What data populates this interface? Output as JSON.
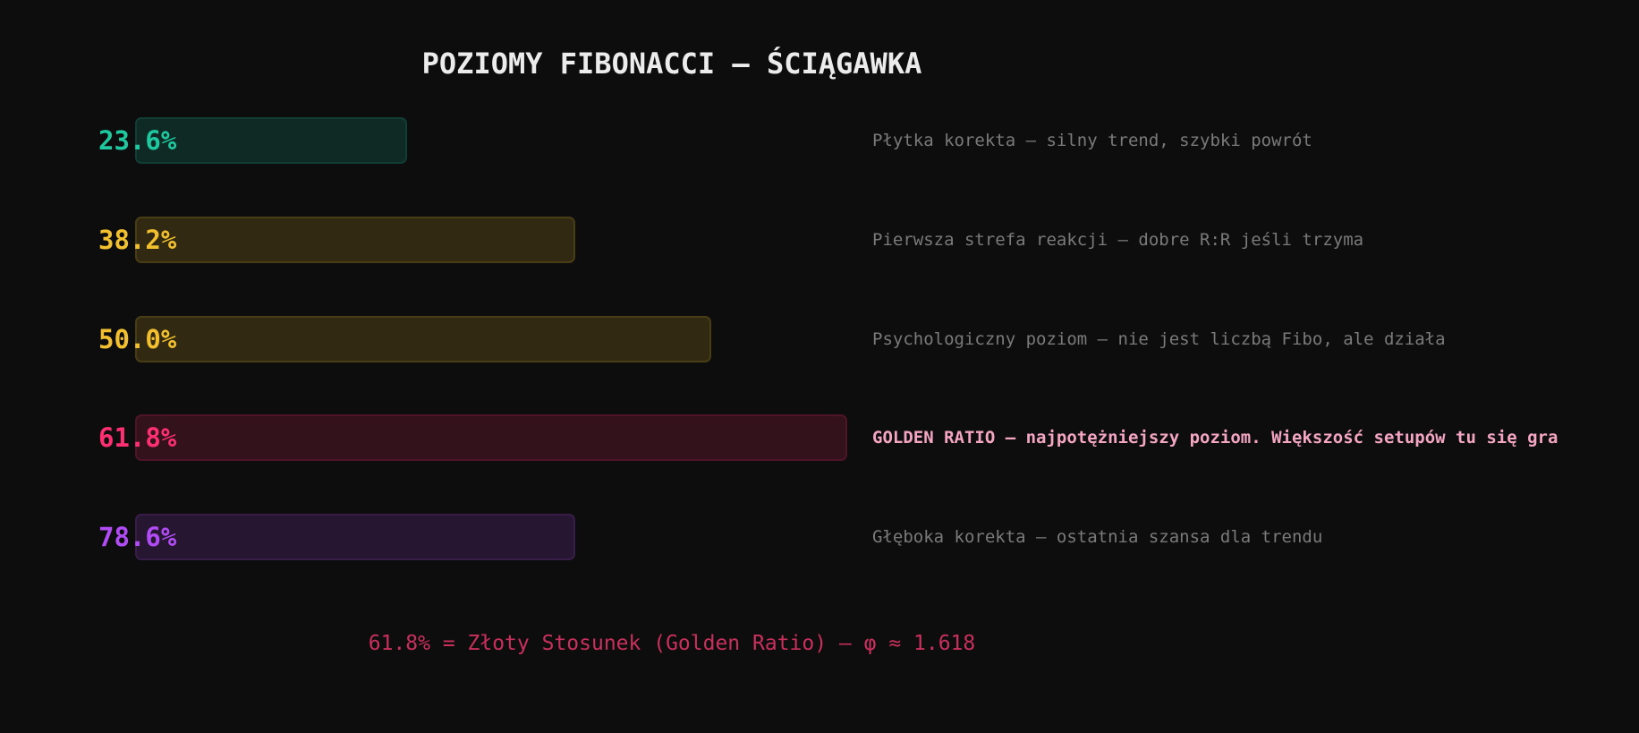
{
  "title": "POZIOMY FIBONACCI — ŚCIĄGAWKA",
  "footnote": "61.8% = Złoty Stosunek (Golden Ratio) — φ ≈ 1.618",
  "chart_data": {
    "type": "bar",
    "orientation": "horizontal",
    "title": "POZIOMY FIBONACCI — ŚCIĄGAWKA",
    "categories": [
      "23.6%",
      "38.2%",
      "50.0%",
      "61.8%",
      "78.6%"
    ],
    "values": [
      23.6,
      38.2,
      50.0,
      61.8,
      38.2
    ],
    "annotations": [
      "Płytka korekta — silny trend, szybki powrót",
      "Pierwsza strefa reakcji — dobre R:R jeśli trzyma",
      "Psychologiczny poziom — nie jest liczbą Fibo, ale działa",
      "GOLDEN RATIO — najpotężniejszy poziom. Większość setupów tu się gra",
      "Głęboka korekta — ostatnia szansa dla trendu"
    ],
    "colors": [
      "#1ec9a0",
      "#f2c02e",
      "#f2c02e",
      "#ff2f73",
      "#b14cf5"
    ],
    "highlight_index": 3,
    "xlim": [
      0,
      61.8
    ],
    "grid": false,
    "legend": "none"
  }
}
